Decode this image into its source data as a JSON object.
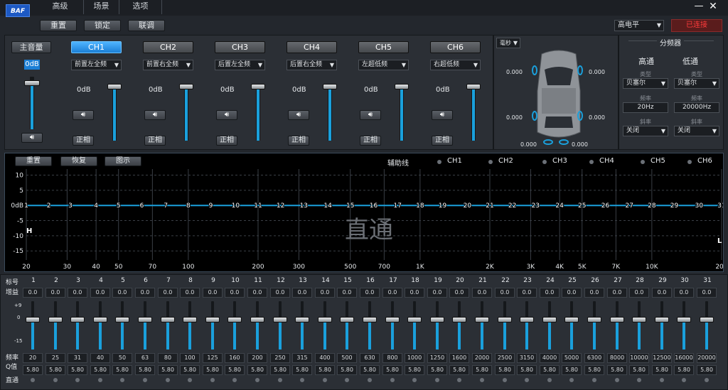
{
  "app": {
    "logo": "BAF",
    "tabs": [
      "高级",
      "场景",
      "选项"
    ],
    "min_icon": "minimize-icon",
    "close_icon": "close-icon"
  },
  "toolbar": {
    "reset": "重置",
    "lock": "锁定",
    "link": "联调",
    "level_select": "高电平",
    "red_btn": "已连接"
  },
  "master": {
    "label": "主音量",
    "value": "0dB",
    "fill_fraction": 1.0
  },
  "channels": [
    {
      "name": "CH1",
      "select": "前置左全频",
      "gain": "0dB",
      "phase": "正相",
      "active": true
    },
    {
      "name": "CH2",
      "select": "前置右全频",
      "gain": "0dB",
      "phase": "正相",
      "active": false
    },
    {
      "name": "CH3",
      "select": "后置左全频",
      "gain": "0dB",
      "phase": "正相",
      "active": false
    },
    {
      "name": "CH4",
      "select": "后置右全频",
      "gain": "0dB",
      "phase": "正相",
      "active": false
    },
    {
      "name": "CH5",
      "select": "左超低频",
      "gain": "0dB",
      "phase": "正相",
      "active": false
    },
    {
      "name": "CH6",
      "select": "右超低频",
      "gain": "0dB",
      "phase": "正相",
      "active": false
    }
  ],
  "delay": {
    "unit_select": "毫秒",
    "fl": "0.000",
    "fr": "0.000",
    "rl": "0.000",
    "rr": "0.000",
    "sub_l": "0.000",
    "sub_r": "0.000"
  },
  "crossover": {
    "title": "分频器",
    "hp": "高通",
    "lp": "低通",
    "type_label": "类型",
    "type_hp": "贝塞尔",
    "type_lp": "贝塞尔",
    "freq_label": "频率",
    "freq_hp": "20Hz",
    "freq_lp": "20000Hz",
    "slope_label": "斜率",
    "slope_hp": "关闭",
    "slope_lp": "关闭"
  },
  "eq_toolbar": {
    "reset": "重置",
    "restore": "恢复",
    "chart": "图示",
    "aux": "辅助线",
    "ch": [
      "CH1",
      "CH2",
      "CH3",
      "CH4",
      "CH5",
      "CH6"
    ]
  },
  "chart_data": {
    "type": "line",
    "ylim": [
      -18,
      12
    ],
    "yticks": [
      "10",
      "5",
      "0dB",
      "-5",
      "-10",
      "-15"
    ],
    "xticks": [
      "20",
      "30",
      "40",
      "50",
      "70",
      "100",
      "200",
      "300",
      "500",
      "700",
      "1K",
      "2K",
      "3K",
      "4K",
      "5K",
      "7K",
      "10K",
      "20K"
    ],
    "band_labels": [
      "1",
      "2",
      "3",
      "4",
      "5",
      "6",
      "7",
      "8",
      "9",
      "10",
      "11",
      "12",
      "13",
      "14",
      "15",
      "16",
      "17",
      "18",
      "19",
      "20",
      "21",
      "22",
      "23",
      "24",
      "25",
      "26",
      "27",
      "28",
      "29",
      "30",
      "31"
    ],
    "overlay": "直通",
    "h_marker": "H",
    "l_marker": "L",
    "series": [
      {
        "values": [
          0,
          0,
          0,
          0,
          0,
          0,
          0,
          0,
          0,
          0,
          0,
          0,
          0,
          0,
          0,
          0,
          0,
          0,
          0,
          0,
          0,
          0,
          0,
          0,
          0,
          0,
          0,
          0,
          0,
          0,
          0
        ]
      }
    ]
  },
  "bands": {
    "label_band": "标号",
    "label_gain": "增益",
    "label_freq": "频率",
    "label_q": "Q值",
    "label_bypass": "直通",
    "scale_top": "+9",
    "scale_mid": "0",
    "scale_bot": "-15",
    "numbers": [
      "1",
      "2",
      "3",
      "4",
      "5",
      "6",
      "7",
      "8",
      "9",
      "10",
      "11",
      "12",
      "13",
      "14",
      "15",
      "16",
      "17",
      "18",
      "19",
      "20",
      "21",
      "22",
      "23",
      "24",
      "25",
      "26",
      "27",
      "28",
      "29",
      "30",
      "31"
    ],
    "gains": [
      "0.0",
      "0.0",
      "0.0",
      "0.0",
      "0.0",
      "0.0",
      "0.0",
      "0.0",
      "0.0",
      "0.0",
      "0.0",
      "0.0",
      "0.0",
      "0.0",
      "0.0",
      "0.0",
      "0.0",
      "0.0",
      "0.0",
      "0.0",
      "0.0",
      "0.0",
      "0.0",
      "0.0",
      "0.0",
      "0.0",
      "0.0",
      "0.0",
      "0.0",
      "0.0",
      "0.0"
    ],
    "freqs": [
      "20",
      "25",
      "31",
      "40",
      "50",
      "63",
      "80",
      "100",
      "125",
      "160",
      "200",
      "250",
      "315",
      "400",
      "500",
      "630",
      "800",
      "1000",
      "1250",
      "1600",
      "2000",
      "2500",
      "3150",
      "4000",
      "5000",
      "6300",
      "8000",
      "10000",
      "12500",
      "16000",
      "20000"
    ],
    "qs": [
      "5.80",
      "5.80",
      "5.80",
      "5.80",
      "5.80",
      "5.80",
      "5.80",
      "5.80",
      "5.80",
      "5.80",
      "5.80",
      "5.80",
      "5.80",
      "5.80",
      "5.80",
      "5.80",
      "5.80",
      "5.80",
      "5.80",
      "5.80",
      "5.80",
      "5.80",
      "5.80",
      "5.80",
      "5.80",
      "5.80",
      "5.80",
      "5.80",
      "5.80",
      "5.80",
      "5.80"
    ]
  }
}
